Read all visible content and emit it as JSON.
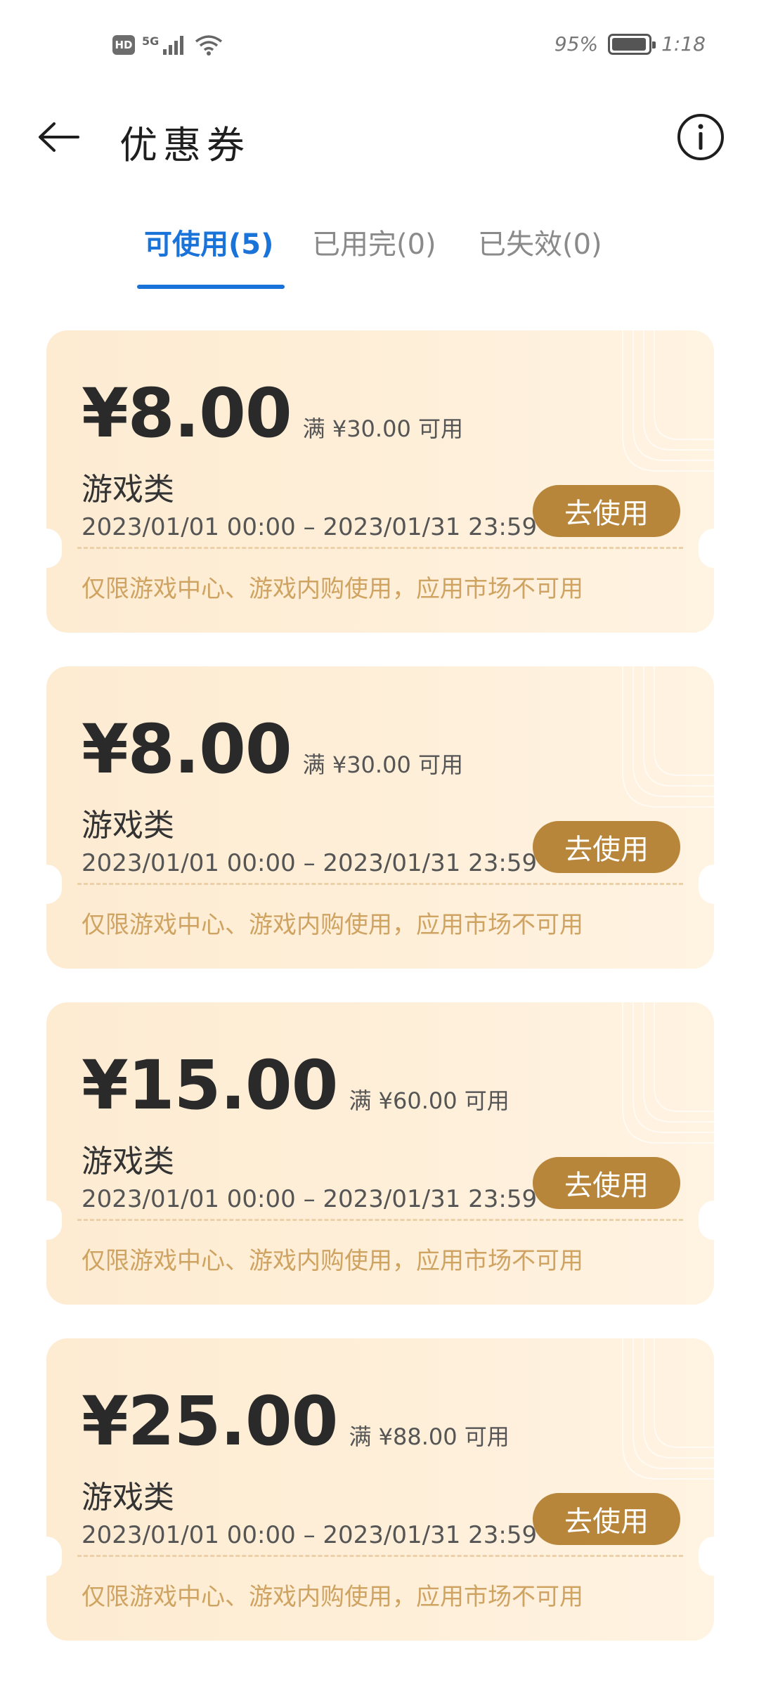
{
  "status_bar": {
    "hd": "HD",
    "network": "5G",
    "battery_text": "95%",
    "battery_level": 0.95,
    "time": "1:18"
  },
  "header": {
    "title": "优惠券"
  },
  "tabs": [
    {
      "label": "可使用(5)",
      "active": true
    },
    {
      "label": "已用完(0)",
      "active": false
    },
    {
      "label": "已失效(0)",
      "active": false
    }
  ],
  "coupons": [
    {
      "amount": "¥8.00",
      "threshold": "满 ¥30.00 可用",
      "category": "游戏类",
      "validity": "2023/01/01 00:00 – 2023/01/31 23:59",
      "button": "去使用",
      "restriction": "仅限游戏中心、游戏内购使用，应用市场不可用"
    },
    {
      "amount": "¥8.00",
      "threshold": "满 ¥30.00 可用",
      "category": "游戏类",
      "validity": "2023/01/01 00:00 – 2023/01/31 23:59",
      "button": "去使用",
      "restriction": "仅限游戏中心、游戏内购使用，应用市场不可用"
    },
    {
      "amount": "¥15.00",
      "threshold": "满 ¥60.00 可用",
      "category": "游戏类",
      "validity": "2023/01/01 00:00 – 2023/01/31 23:59",
      "button": "去使用",
      "restriction": "仅限游戏中心、游戏内购使用，应用市场不可用"
    },
    {
      "amount": "¥25.00",
      "threshold": "满 ¥88.00 可用",
      "category": "游戏类",
      "validity": "2023/01/01 00:00 – 2023/01/31 23:59",
      "button": "去使用",
      "restriction": "仅限游戏中心、游戏内购使用，应用市场不可用"
    }
  ],
  "colors": {
    "accent": "#1a73d9",
    "button": "#b8863a",
    "coupon_bg": "#fdecd2",
    "restriction_text": "#cfa361"
  },
  "icons": {
    "back": "arrow-left-icon",
    "info": "info-circle-icon",
    "signal": "signal-icon",
    "wifi": "wifi-icon",
    "battery": "battery-icon"
  }
}
